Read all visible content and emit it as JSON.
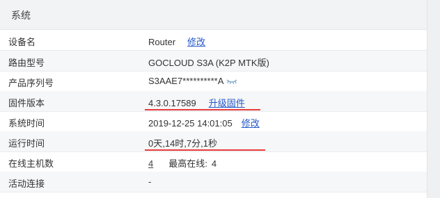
{
  "header": {
    "title": "系统"
  },
  "rows": {
    "device_name": {
      "label": "设备名",
      "value": "Router",
      "action": "修改"
    },
    "model": {
      "label": "路由型号",
      "value": "GOCLOUD S3A (K2P MTK版)"
    },
    "serial": {
      "label": "产品序列号",
      "value": "S3AAE7**********A"
    },
    "firmware": {
      "label": "固件版本",
      "value": "4.3.0.17589",
      "action": "升级固件"
    },
    "system_time": {
      "label": "系统时间",
      "value": "2019-12-25 14:01:05",
      "action": "修改"
    },
    "uptime": {
      "label": "运行时间",
      "value": "0天,14时,7分,1秒"
    },
    "online_hosts": {
      "label": "在线主机数",
      "value": "4",
      "peak_label": "最高在线:",
      "peak_value": "4"
    },
    "active_connections": {
      "label": "活动连接",
      "value": "-"
    }
  },
  "icons": {
    "serial_reveal": "eye-closed-icon"
  },
  "colors": {
    "link": "#2458c9",
    "highlight_underline": "#e83a3a",
    "header_bg": "#f2f3f4"
  }
}
